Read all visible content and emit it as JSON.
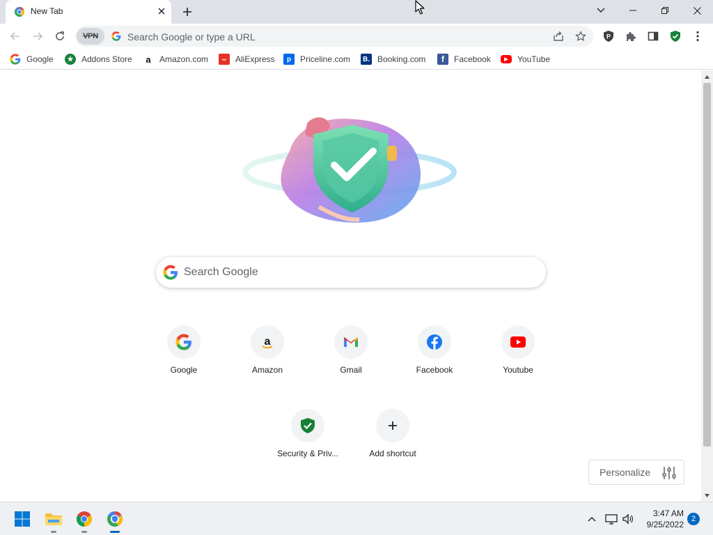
{
  "tab": {
    "title": "New Tab",
    "close_icon": "close-icon"
  },
  "window_controls": [
    "chevron-down-icon",
    "minimize-icon",
    "restore-icon",
    "close-icon"
  ],
  "toolbar": {
    "vpn_label": "VPN",
    "omnibox_placeholder": "Search Google or type a URL",
    "icons": [
      "back-icon",
      "forward-icon",
      "reload-icon",
      "share-icon",
      "star-icon",
      "shield-p-icon",
      "extensions-icon",
      "side-panel-icon",
      "security-shield-icon",
      "menu-icon"
    ]
  },
  "bookmarks": [
    {
      "label": "Google",
      "icon": "google-icon"
    },
    {
      "label": "Addons Store",
      "icon": "addons-store-icon"
    },
    {
      "label": "Amazon.com",
      "icon": "amazon-icon"
    },
    {
      "label": "AliExpress",
      "icon": "aliexpress-icon"
    },
    {
      "label": "Priceline.com",
      "icon": "priceline-icon"
    },
    {
      "label": "Booking.com",
      "icon": "booking-icon"
    },
    {
      "label": "Facebook",
      "icon": "facebook-icon"
    },
    {
      "label": "YouTube",
      "icon": "youtube-icon"
    }
  ],
  "search": {
    "placeholder": "Search Google"
  },
  "shortcuts": [
    {
      "label": "Google",
      "icon": "google-icon"
    },
    {
      "label": "Amazon",
      "icon": "amazon-icon"
    },
    {
      "label": "Gmail",
      "icon": "gmail-icon"
    },
    {
      "label": "Facebook",
      "icon": "facebook-icon"
    },
    {
      "label": "Youtube",
      "icon": "youtube-icon"
    },
    {
      "label": "Security & Priv...",
      "icon": "security-shield-icon"
    },
    {
      "label": "Add shortcut",
      "icon": "plus-icon"
    }
  ],
  "personalize": {
    "label": "Personalize",
    "icon": "sliders-icon"
  },
  "taskbar": {
    "apps": [
      "windows-start-icon",
      "file-explorer-icon",
      "chrome-icon",
      "browser-icon"
    ],
    "tray": [
      "chevron-up-icon",
      "network-icon",
      "volume-icon"
    ],
    "time": "3:47 AM",
    "date": "9/25/2022",
    "notifications": "2"
  },
  "colors": {
    "accent_blue": "#4285f4",
    "security_green": "#188038",
    "taskbar_accent": "#0067c0",
    "youtube_red": "#ff0000",
    "facebook_blue": "#1877f2"
  }
}
